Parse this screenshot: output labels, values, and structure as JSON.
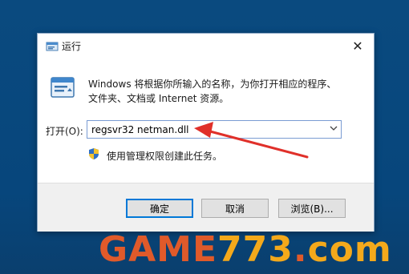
{
  "window": {
    "title": "运行",
    "close_label": "✕"
  },
  "dialog": {
    "description_line1": "Windows 将根据你所输入的名称，为你打开相应的程序、",
    "description_line2": "文件夹、文档或 Internet 资源。",
    "open_label": "打开(O):",
    "open_value": "regsvr32 netman.dll",
    "admin_text": "使用管理权限创建此任务。"
  },
  "buttons": {
    "ok": "确定",
    "cancel": "取消",
    "browse": "浏览(B)..."
  },
  "watermark": {
    "brand": "GAME",
    "number": "773",
    "dot": ".",
    "tld": "com"
  },
  "colors": {
    "desktop": "#0a4a7f",
    "accent": "#0078d7",
    "arrow": "#e0302a",
    "watermark_red": "#e05a2a",
    "watermark_orange": "#f4a91b"
  },
  "icons": [
    "run-app-icon",
    "run-large-icon",
    "shield-icon",
    "close-icon",
    "chevron-down-icon"
  ]
}
